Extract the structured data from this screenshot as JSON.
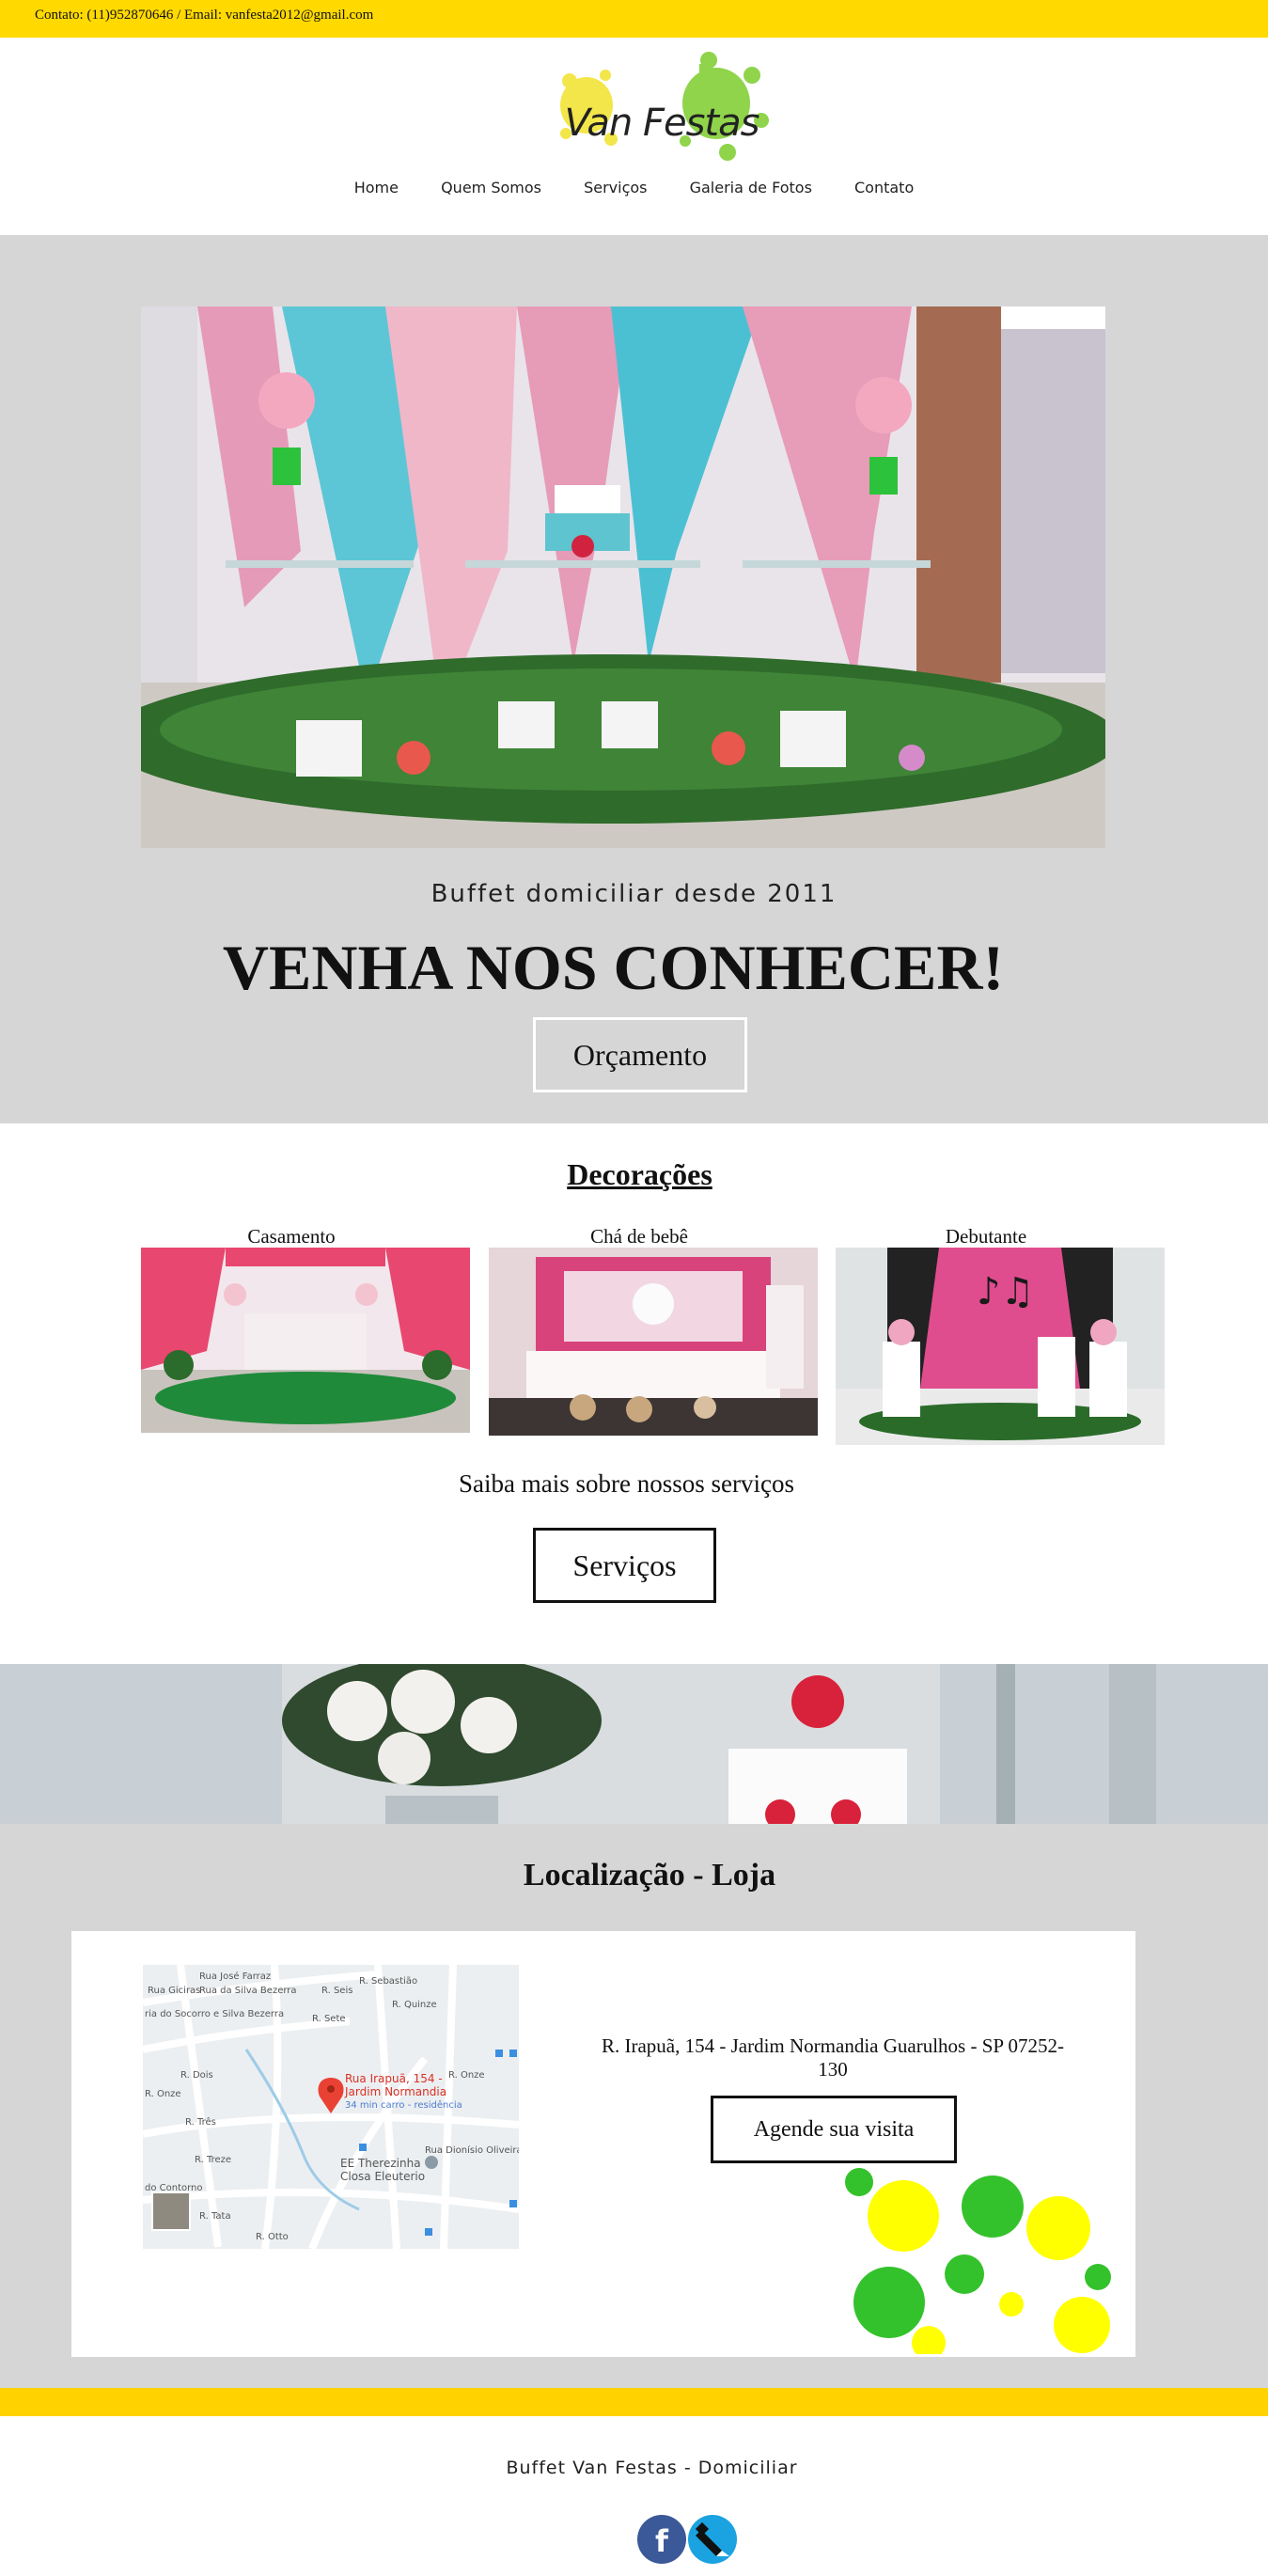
{
  "topbar": {
    "contact": "Contato: (11)952870646 / Email: vanfesta2012@gmail.com",
    "color": "#ffd900"
  },
  "logo": {
    "text": "Van Festas"
  },
  "nav": {
    "items": [
      "Home",
      "Quem Somos",
      "Serviços",
      "Galeria de Fotos",
      "Contato"
    ]
  },
  "hero": {
    "subtitle": "Buffet domiciliar desde 2011",
    "headline": "VENHA NOS CONHECER!",
    "button": "Orçamento",
    "background": "#d6d6d6"
  },
  "decoracoes": {
    "title": "Decorações",
    "cards": [
      {
        "label": "Casamento"
      },
      {
        "label": "Chá de bebê"
      },
      {
        "label": "Debutante"
      }
    ],
    "more_text": "Saiba mais sobre nossos serviços",
    "button": "Serviços"
  },
  "localizacao": {
    "title": "Localização - Loja",
    "map": {
      "pin_label_1": "Rua Irapuã, 154 -",
      "pin_label_2": "Jardim Normandia",
      "pin_sub": "34 min carro - residência",
      "poi_1": "EE Therezinha",
      "poi_2": "Closa Eleuterio",
      "streets": [
        "Rua Giciras",
        "Rua José Farraz",
        "Rua da Silva Bezerra",
        "ria do Socorro e Silva Bezerra",
        "R. Seis",
        "R. Sebastião",
        "R. Dois",
        "R. Três",
        "R. Treze",
        "do Contorno",
        "R. Tata",
        "R. Onze",
        "R. Otto",
        "R. Onze",
        "R. Sete",
        "Rua Dionísio Oliveira de Abreu",
        "R. Quinze"
      ]
    },
    "address": "R. Irapuã, 154 - Jardim Normandia Guarulhos - SP 07252-130",
    "button": "Agende sua visita"
  },
  "footer": {
    "name": "Buffet Van Festas - Domiciliar",
    "bar_color": "#ffd200"
  },
  "social": {
    "icons": [
      "facebook-icon",
      "blog-icon"
    ]
  }
}
